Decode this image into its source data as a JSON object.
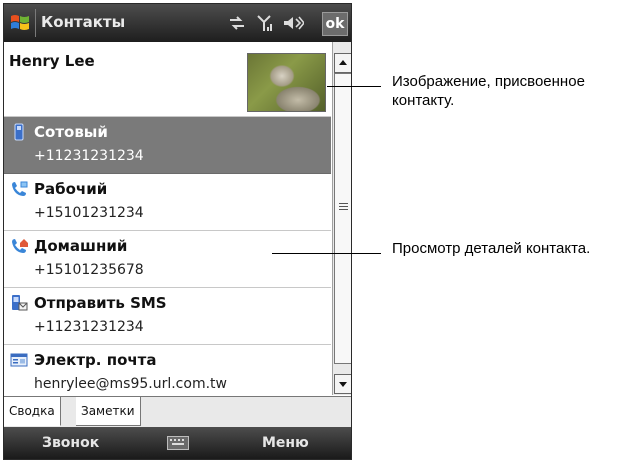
{
  "titlebar": {
    "title": "Контакты",
    "ok_label": "ok"
  },
  "contact": {
    "name": "Henry Lee"
  },
  "fields": [
    {
      "label": "Сотовый",
      "value": "+11231231234",
      "icon": "mobile-phone-icon",
      "selected": true
    },
    {
      "label": "Рабочий",
      "value": "+15101231234",
      "icon": "work-phone-icon",
      "selected": false
    },
    {
      "label": "Домашний",
      "value": "+15101235678",
      "icon": "home-phone-icon",
      "selected": false
    },
    {
      "label": "Отправить SMS",
      "value": "+11231231234",
      "icon": "sms-icon",
      "selected": false
    },
    {
      "label": "Электр. почта",
      "value": "henrylee@ms95.url.com.tw",
      "icon": "email-icon",
      "selected": false
    }
  ],
  "tabs": [
    {
      "label": "Сводка",
      "active": true
    },
    {
      "label": "Заметки",
      "active": false
    }
  ],
  "softkeys": {
    "left": "Звонок",
    "right": "Меню"
  },
  "callouts": {
    "photo": "Изображение, присвоенное контакту.",
    "details": "Просмотр деталей контакта."
  },
  "colors": {
    "titlebar": "#2e2e2e",
    "selected_row": "#7a7a7a"
  }
}
